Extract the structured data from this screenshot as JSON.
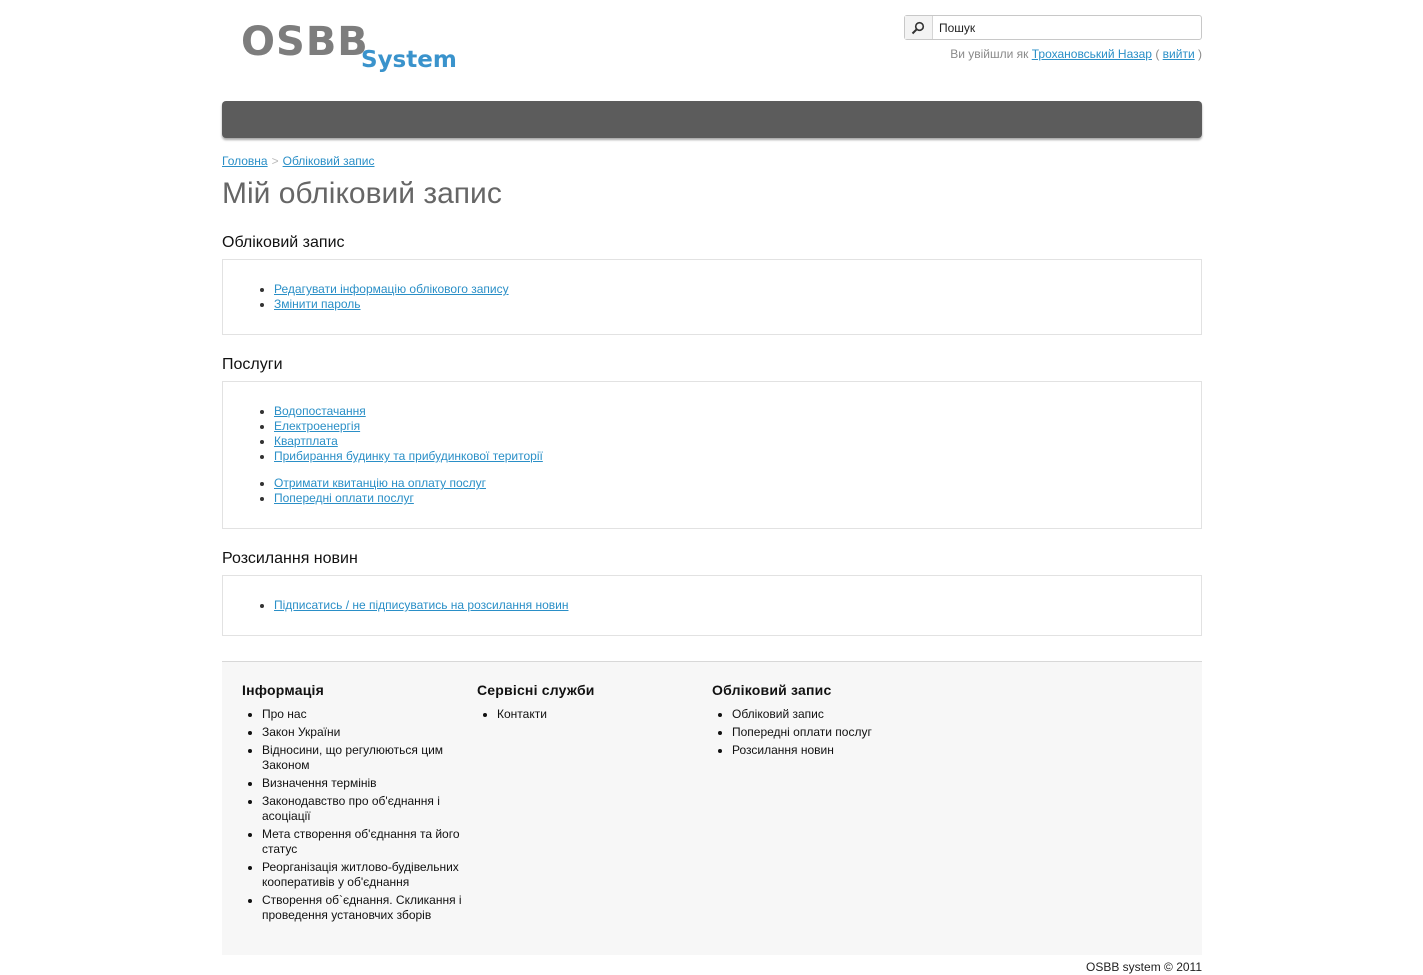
{
  "logo": {
    "part1": "OSBB",
    "part2": "System"
  },
  "search": {
    "placeholder": "Пошук"
  },
  "login": {
    "prefix": "Ви увійшли як",
    "user_name": "Трохановський Назар",
    "open_paren": "(",
    "logout_label": "вийти",
    "close_paren": ")"
  },
  "breadcrumb": {
    "home": "Головна",
    "separator": ">",
    "current": "Обліковий запис"
  },
  "page_title": "Мій обліковий запис",
  "sections": {
    "account": {
      "title": "Обліковий запис",
      "links": [
        "Редагувати інформацію облікового запису",
        "Змінити пароль"
      ]
    },
    "services": {
      "title": "Послуги",
      "links": [
        "Водопостачання",
        "Електроенергія",
        "Квартплата",
        "Прибирання будинку та прибудинкової території"
      ],
      "links2": [
        "Отримати квитанцію на оплату послуг",
        "Попередні оплати послуг"
      ]
    },
    "newsletter": {
      "title": "Розсилання новин",
      "links": [
        "Підписатись / не підписуватись на розсилання новин"
      ]
    }
  },
  "footer": {
    "info": {
      "title": "Інформація",
      "items": [
        "Про нас",
        "Закон України",
        "Відносини, що регулюються цим Законом",
        "Визначення термінів",
        "Законодавство про об'єднання і асоціації",
        "Мета створення об'єднання та його статус",
        "Реорганізація житлово-будівельних кооперативів у об'єднання",
        "Створення об`єднання. Скликання і проведення установчих зборів"
      ]
    },
    "services": {
      "title": "Сервісні служби",
      "items": [
        "Контакти"
      ]
    },
    "account": {
      "title": "Обліковий запис",
      "items": [
        "Обліковий запис",
        "Попередні оплати послуг",
        "Розсилання новин"
      ]
    },
    "copyright": "OSBB system © 2011"
  }
}
